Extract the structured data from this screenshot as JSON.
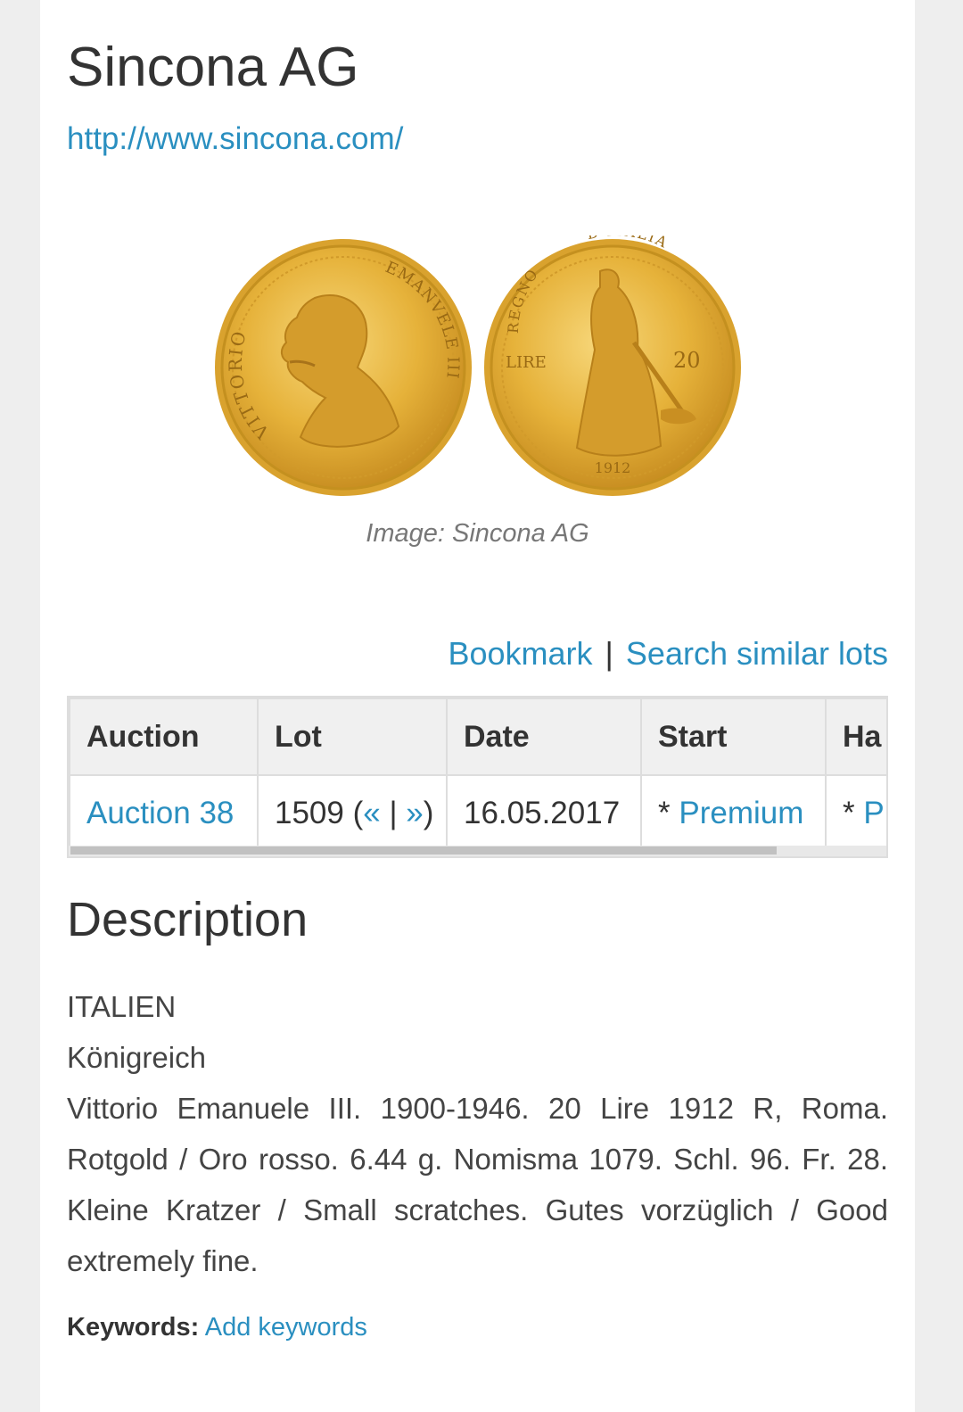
{
  "header": {
    "title": "Sincona AG",
    "url": "http://www.sincona.com/"
  },
  "image": {
    "caption": "Image: Sincona AG",
    "obverse_legend_left": "VITTORIO",
    "obverse_legend_right": "EMANVELE III",
    "reverse_legend_top_left": "REGNO",
    "reverse_legend_top_right": "D'ITALIA",
    "reverse_denomination_label": "LIRE",
    "reverse_denomination_value": "20",
    "reverse_year": "1912"
  },
  "actions": {
    "bookmark": "Bookmark",
    "separator": "|",
    "search_similar": "Search similar lots"
  },
  "table": {
    "headers": [
      "Auction",
      "Lot",
      "Date",
      "Start",
      "Ha"
    ],
    "row": {
      "auction": "Auction 38",
      "lot_number": "1509",
      "lot_open": "(",
      "prev": "«",
      "lot_sep": "|",
      "next": "»",
      "lot_close": ")",
      "date": "16.05.2017",
      "start_prefix": "* ",
      "start_link": "Premium",
      "hammer_prefix": "* ",
      "hammer_link": "P"
    }
  },
  "description": {
    "heading": "Description",
    "line1": "ITALIEN",
    "line2": "Königreich",
    "body": "Vittorio Emanuele III. 1900-1946. 20 Lire 1912 R, Roma. Rotgold / Oro rosso. 6.44 g. Nomisma 1079. Schl. 96. Fr. 28. Kleine Kratzer / Small scratches. Gutes vorzüglich / Good extremely fine."
  },
  "keywords": {
    "label": "Keywords:",
    "link": "Add keywords"
  },
  "colors": {
    "link": "#2a8fc0",
    "gold": "#e6b23a",
    "page_bg": "#eeeeee"
  }
}
